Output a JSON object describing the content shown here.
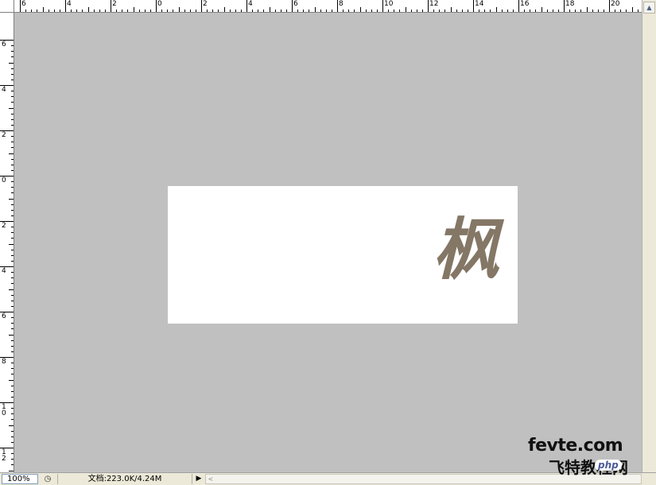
{
  "rulers": {
    "top_labels": [
      "6",
      "4",
      "2",
      "0",
      "2",
      "4",
      "6",
      "8",
      "10",
      "12",
      "14",
      "16",
      "18",
      "20"
    ],
    "left_labels": [
      "6",
      "4",
      "2",
      "0",
      "2",
      "4",
      "6",
      "8",
      "10",
      "12"
    ]
  },
  "canvas": {
    "glyph_text": "枫",
    "glyph_color": "#847766",
    "document_color": "#ffffff",
    "workspace_color": "#c0c0c0"
  },
  "statusbar": {
    "zoom": "100%",
    "doc_info": "文档:223.0K/4.24M",
    "menu_arrow": "▶",
    "scroll_left_arrow": "<"
  },
  "scrollbar": {
    "up_arrow": "▲",
    "down_arrow": "▼"
  },
  "watermark": {
    "line1": "fevte.com",
    "line2": "飞特教程网",
    "badge": "php"
  }
}
